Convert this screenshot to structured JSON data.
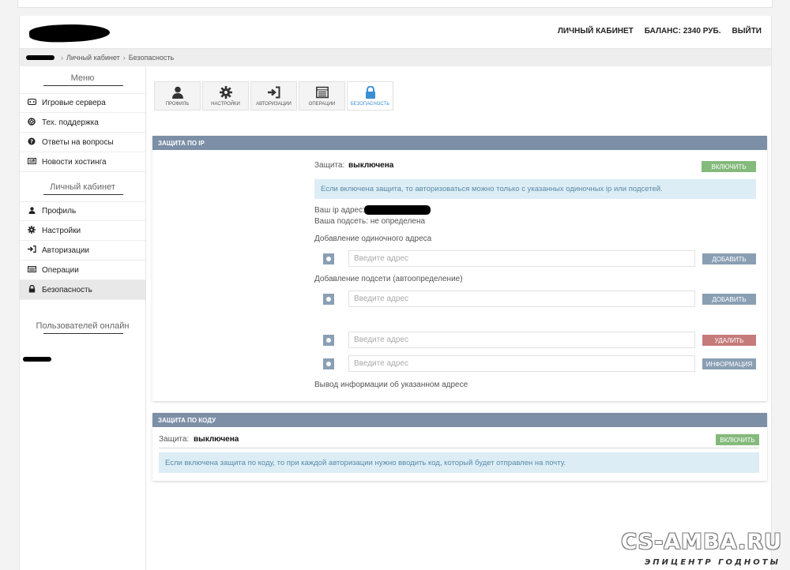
{
  "header": {
    "cabinet": "ЛИЧНЫЙ КАБИНЕТ",
    "balance": "БАЛАНС: 2340 РУБ.",
    "logout": "ВЫЙТИ"
  },
  "breadcrumb": {
    "cabinet": "Личный кабинет",
    "security": "Безопасность"
  },
  "sidebar": {
    "menu_title": "Меню",
    "menu_items": [
      {
        "label": "Игровые сервера",
        "icon": "gamepad-icon"
      },
      {
        "label": "Тех. поддержка",
        "icon": "lifebuoy-icon"
      },
      {
        "label": "Ответы на вопросы",
        "icon": "question-icon"
      },
      {
        "label": "Новости хостинга",
        "icon": "newspaper-icon"
      }
    ],
    "cabinet_title": "Личный кабинет",
    "cabinet_items": [
      {
        "label": "Профиль",
        "icon": "user-icon"
      },
      {
        "label": "Настройки",
        "icon": "gear-icon"
      },
      {
        "label": "Авторизации",
        "icon": "sign-in-icon"
      },
      {
        "label": "Операции",
        "icon": "list-icon"
      },
      {
        "label": "Безопасность",
        "icon": "lock-icon"
      }
    ],
    "online_title": "Пользователей онлайн"
  },
  "tabs": [
    {
      "label": "ПРОФИЛЬ",
      "icon": "user-icon"
    },
    {
      "label": "НАСТРОЙКИ",
      "icon": "gear-icon"
    },
    {
      "label": "АВТОРИЗАЦИИ",
      "icon": "sign-in-icon"
    },
    {
      "label": "ОПЕРАЦИИ",
      "icon": "list-icon"
    },
    {
      "label": "БЕЗОПАСНОСТЬ",
      "icon": "lock-icon"
    }
  ],
  "ip_panel": {
    "title": "ЗАЩИТА ПО IP",
    "protection_label": "Защита:",
    "protection_value": "выключена",
    "enable_button": "ВКЛЮЧИТЬ",
    "info": "Если включена защита, то авторизоваться можно только с указанных одиночных ip или подсетей.",
    "your_ip_label": "Ваш ip адрес:",
    "your_subnet": "Ваша подсеть: не определена",
    "single_title": "Добавление одиночного адреса",
    "subnet_title": "Добавление подсети (автоопределение)",
    "placeholder": "Введите адрес",
    "add_button": "ДОБАВИТЬ",
    "delete_button": "УДАЛИТЬ",
    "info_button": "ИНФОРМАЦИЯ",
    "footer_note": "Вывод информации об указанном адресе"
  },
  "code_panel": {
    "title": "ЗАЩИТА ПО КОДУ",
    "protection_label": "Защита:",
    "protection_value": "выключена",
    "enable_button": "ВКЛЮЧИТЬ",
    "info": "Если включена защита по коду, то при каждой авторизации нужно вводить код, который будет отправлен на почту."
  },
  "watermark": {
    "main": "CS-AMBA.RU",
    "sub": "ЭПИЦЕНТР ГОДНОТЫ"
  },
  "colors": {
    "panel_header": "#7c8fa6",
    "green_button": "#84ba7c",
    "blue_button": "#8a9fb4",
    "red_button": "#c67b7b",
    "info_bg": "#dcedf5",
    "active_tab": "#3a8fd6"
  }
}
